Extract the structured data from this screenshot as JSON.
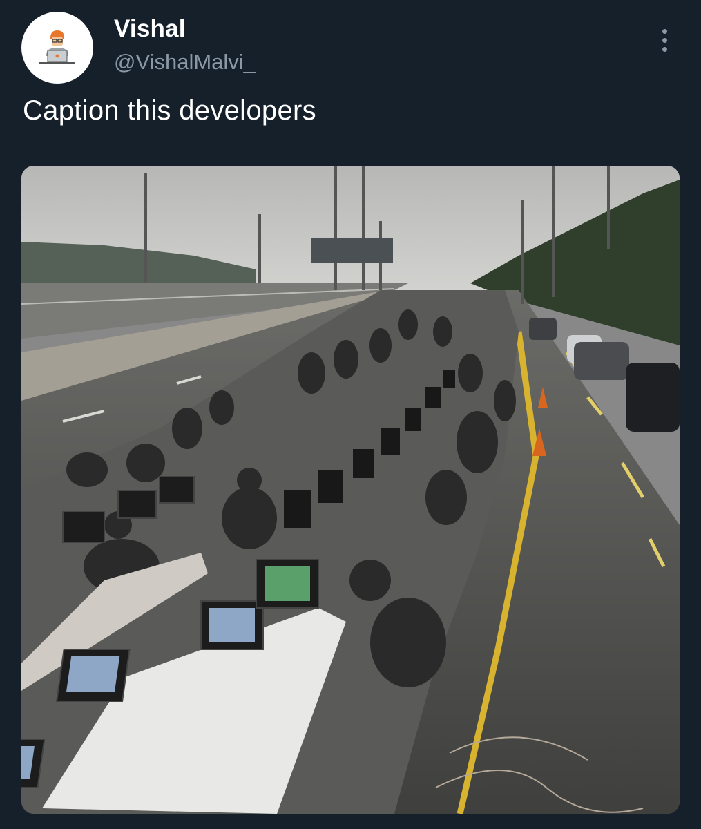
{
  "tweet": {
    "author_name": "Vishal",
    "author_handle": "@VishalMalvi_",
    "text": "Caption this developers"
  },
  "icons": {
    "avatar": "developer-at-laptop-avatar",
    "more": "more-vertical-icon"
  },
  "colors": {
    "background": "#15202b",
    "secondary_text": "#8b98a5",
    "primary_text": "#ffffff"
  }
}
